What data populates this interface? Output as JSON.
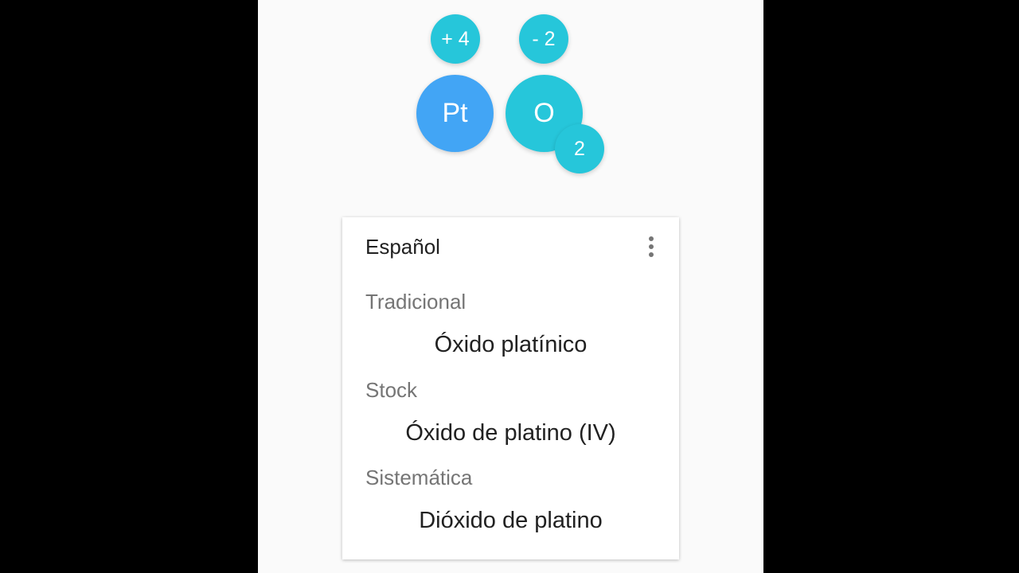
{
  "colors": {
    "metal_bubble": "#42a5f5",
    "nonmetal_bubble": "#26c6da",
    "background": "#fafafa",
    "card": "#ffffff"
  },
  "formula": {
    "cation": {
      "symbol": "Pt",
      "charge": "+ 4"
    },
    "anion": {
      "symbol": "O",
      "charge": "- 2",
      "subscript": "2"
    }
  },
  "card": {
    "title": "Español",
    "menu_icon": "more-vert-icon",
    "sections": [
      {
        "label": "Tradicional",
        "value": "Óxido platínico"
      },
      {
        "label": "Stock",
        "value": "Óxido de platino (IV)"
      },
      {
        "label": "Sistemática",
        "value": "Dióxido de platino"
      }
    ]
  }
}
